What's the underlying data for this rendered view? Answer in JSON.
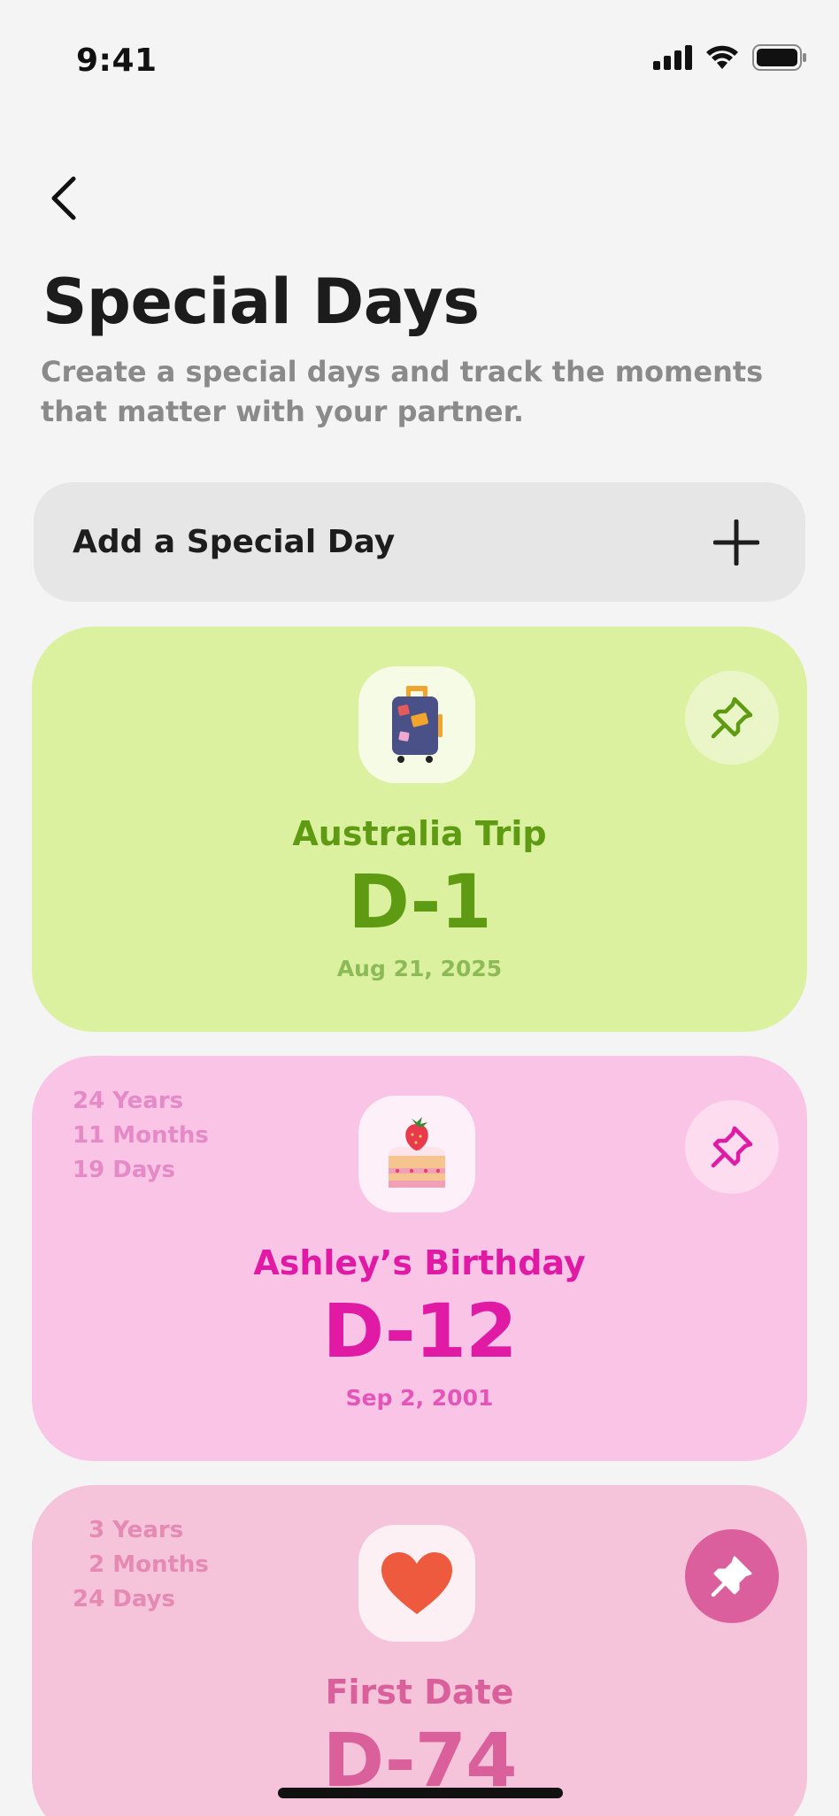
{
  "status_bar": {
    "time": "9:41"
  },
  "header": {
    "title": "Special Days",
    "subtitle": "Create a special days and track the moments that matter with your partner."
  },
  "add_button": {
    "label": "Add a Special Day"
  },
  "cards": [
    {
      "name": "Australia Trip",
      "dday": "D-1",
      "date": "Aug 21, 2025",
      "icon": "suitcase-icon",
      "pinned": false,
      "color": "#dbf1a0"
    },
    {
      "name": "Ashley’s Birthday",
      "dday": "D-12",
      "date": "Sep 2, 2001",
      "icon": "cake-icon",
      "pinned": false,
      "color": "#fac4e7",
      "elapsed": {
        "years": "24 Years",
        "months": "11 Months",
        "days": "19 Days"
      }
    },
    {
      "name": "First Date",
      "dday": "D-74",
      "icon": "heart-icon",
      "pinned": true,
      "color": "#f5c4da",
      "elapsed": {
        "years": "  3 Years",
        "months": "  2 Months",
        "days": "24 Days"
      }
    }
  ]
}
